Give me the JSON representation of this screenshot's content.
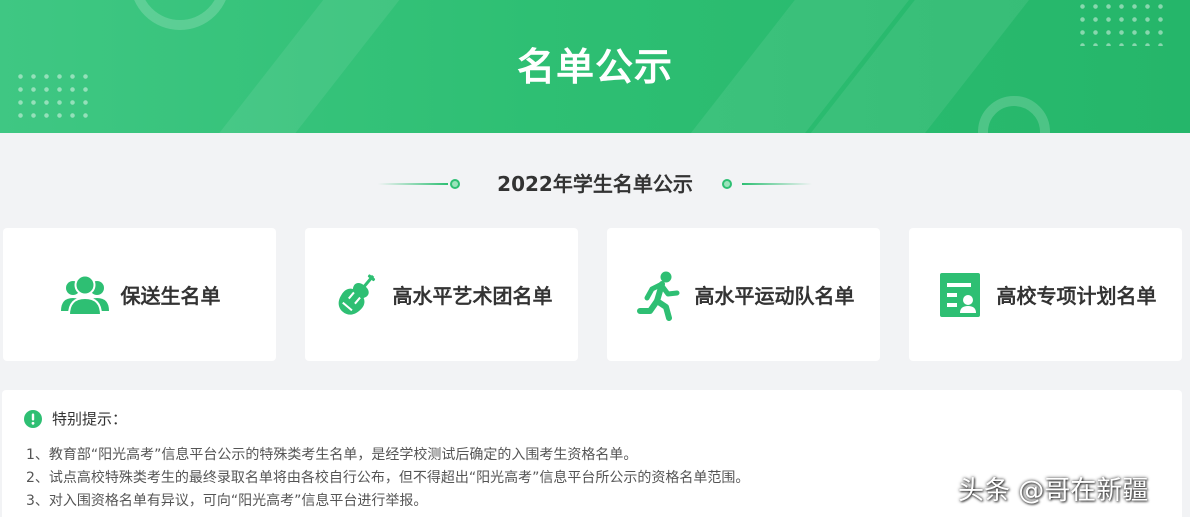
{
  "banner": {
    "title": "名单公示"
  },
  "section": {
    "title": "2022年学生名单公示"
  },
  "cards": [
    {
      "label": "保送生名单",
      "icon": "people-group-icon"
    },
    {
      "label": "高水平艺术团名单",
      "icon": "violin-icon"
    },
    {
      "label": "高水平运动队名单",
      "icon": "running-person-icon"
    },
    {
      "label": "高校专项计划名单",
      "icon": "id-card-icon"
    }
  ],
  "notice": {
    "heading": "特别提示：",
    "icon": "exclamation-circle-icon",
    "items": [
      "1、教育部“阳光高考”信息平台公示的特殊类考生名单，是经学校测试后确定的入围考生资格名单。",
      "2、试点高校特殊类考生的最终录取名单将由各校自行公布，但不得超出“阳光高考”信息平台所公示的资格名单范围。",
      "3、对入围资格名单有异议，可向“阳光高考”信息平台进行举报。"
    ]
  },
  "watermark": {
    "text": "头条 @哥在新疆"
  },
  "colors": {
    "brand_green": "#2ebf73",
    "page_bg": "#f2f3f5",
    "card_bg": "#ffffff"
  }
}
